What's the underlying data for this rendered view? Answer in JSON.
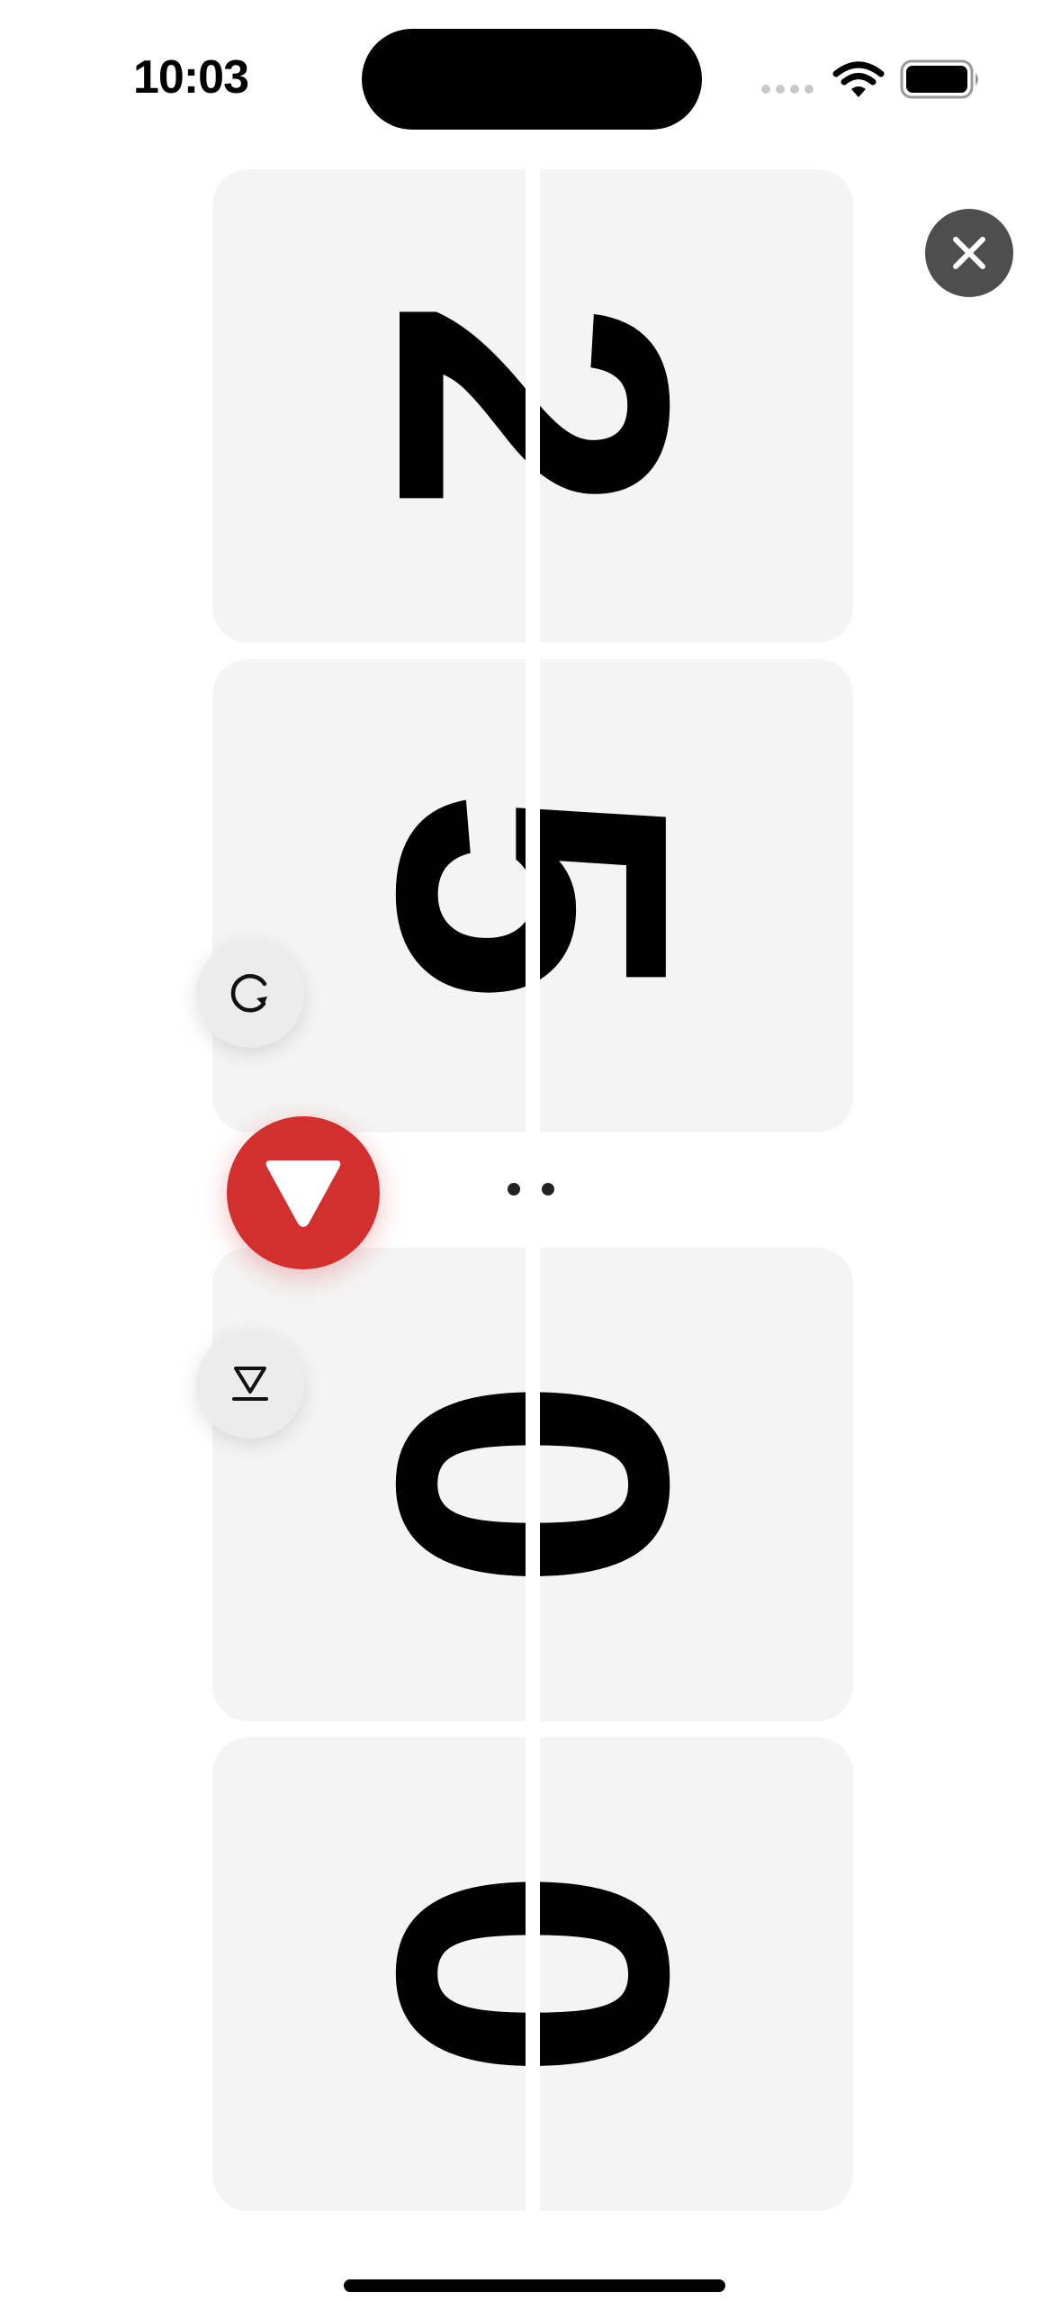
{
  "status_bar": {
    "time": "10:03"
  },
  "display": {
    "digits": [
      "2",
      "5",
      "0",
      "0"
    ],
    "separator": ":",
    "card_color": "#f4f4f4",
    "digit_color": "#000000"
  },
  "controls": {
    "close_icon": "close-icon",
    "reset_icon": "rotate-clockwise-icon",
    "play_icon": "triangle-down-icon",
    "secondary_icon": "triangle-down-bar-icon",
    "accent_color": "#d32f2f"
  }
}
